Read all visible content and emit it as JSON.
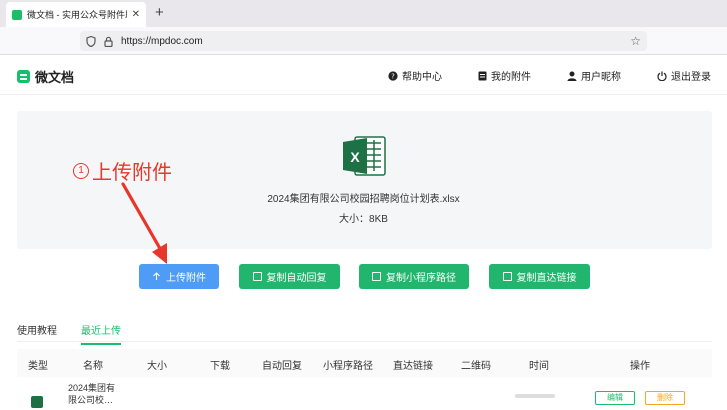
{
  "browser": {
    "tab_title": "微文档 - 实用公众号附件助手,…",
    "url": "https://mpdoc.com"
  },
  "header": {
    "logo": "微文档",
    "nav": [
      {
        "label": "帮助中心",
        "icon": "help-icon"
      },
      {
        "label": "我的附件",
        "icon": "document-icon"
      },
      {
        "label": "用户昵称",
        "icon": "user-icon"
      },
      {
        "label": "退出登录",
        "icon": "power-icon"
      }
    ]
  },
  "upload": {
    "file_name": "2024集团有限公司校园招聘岗位计划表.xlsx",
    "file_size": "大小：8KB",
    "annotation_num": "1",
    "annotation_text": "上传附件"
  },
  "buttons": {
    "upload": "上传附件",
    "copy_auto_reply": "复制自动回复",
    "copy_mini_path": "复制小程序路径",
    "copy_direct_link": "复制直达链接"
  },
  "tabs": [
    "使用教程",
    "最近上传"
  ],
  "table": {
    "headers": [
      "类型",
      "名称",
      "大小",
      "下载",
      "自动回复",
      "小程序路径",
      "直达链接",
      "二维码",
      "时间",
      "操作"
    ],
    "rows": [
      {
        "name_line1": "2024集团有",
        "name_line2": "限公司校…",
        "edit": "编辑",
        "delete": "删除"
      }
    ]
  },
  "colors": {
    "brand": "#19be6b",
    "primary": "#4f9cf7",
    "annotation": "#e8362a"
  }
}
